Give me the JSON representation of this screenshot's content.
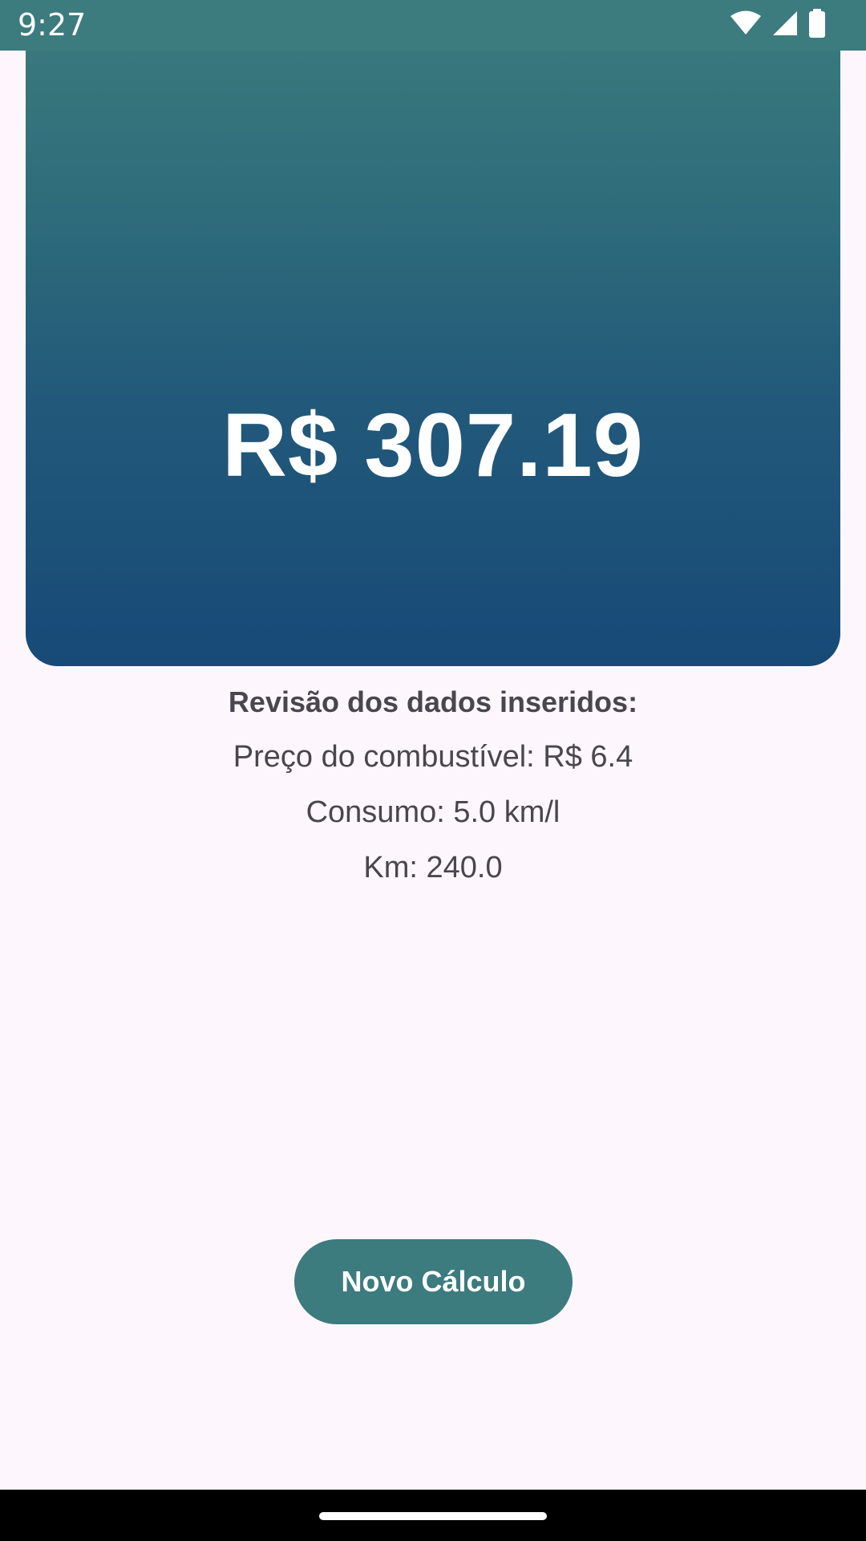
{
  "status_bar": {
    "time": "9:27",
    "icons": [
      "wifi-icon",
      "signal-icon",
      "battery-icon"
    ],
    "background": "#3c7b7e"
  },
  "result": {
    "value": "R$ 307.19",
    "gradient_top": "#3c7b7e",
    "gradient_bottom": "#174a77"
  },
  "review": {
    "title": "Revisão dos dados inseridos:",
    "fuel_price": "Preço do combustível: R$ 6.4",
    "consumption": "Consumo: 5.0 km/l",
    "distance": "Km: 240.0"
  },
  "actions": {
    "new_calc_label": "Novo Cálculo",
    "button_color": "#3c7b7e"
  }
}
